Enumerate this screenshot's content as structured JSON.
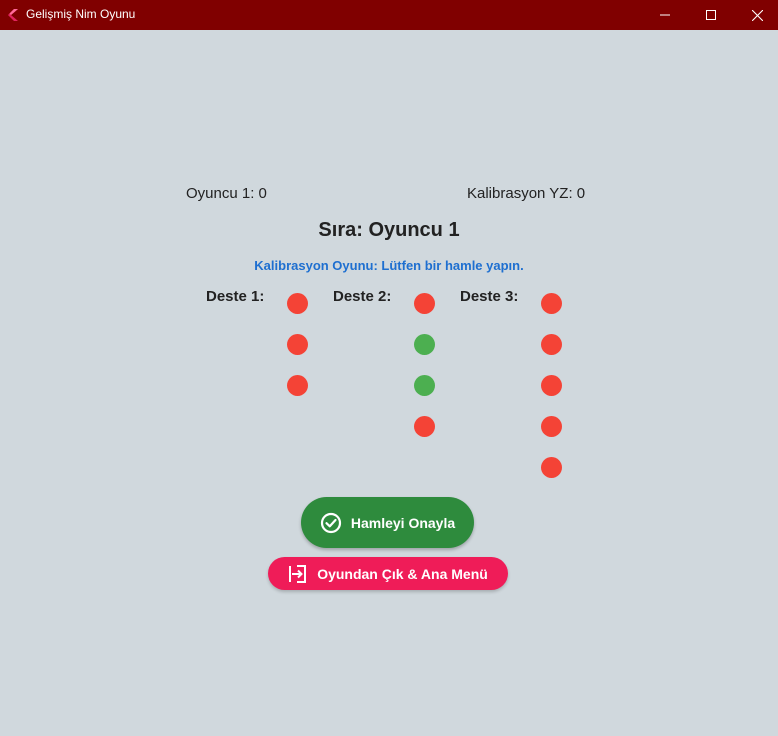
{
  "window": {
    "title": "Gelişmiş Nim Oyunu",
    "icon": "flutter-app-icon",
    "controls": [
      "minimize-icon",
      "maximize-icon",
      "close-icon"
    ]
  },
  "scores": {
    "player1": "Oyuncu 1: 0",
    "ai": "Kalibrasyon YZ: 0"
  },
  "turn": "Sıra: Oyuncu 1",
  "status_message": "Kalibrasyon Oyunu: Lütfen bir hamle yapın.",
  "piles": [
    {
      "label": "Deste 1:",
      "sticks": [
        "red",
        "red",
        "red"
      ]
    },
    {
      "label": "Deste 2:",
      "sticks": [
        "red",
        "green",
        "green",
        "red"
      ]
    },
    {
      "label": "Deste 3:",
      "sticks": [
        "red",
        "red",
        "red",
        "red",
        "red"
      ]
    }
  ],
  "buttons": {
    "confirm": {
      "label": "Hamleyi Onayla",
      "icon": "check-circle-icon"
    },
    "exit": {
      "label": "Oyundan Çık & Ana Menü",
      "icon": "exit-to-app-icon"
    }
  },
  "colors": {
    "titlebar": "#800000",
    "background": "#d0d8dd",
    "stick_default": "#f44336",
    "stick_selected": "#4caf50",
    "status_text": "#1e6fd0",
    "confirm_button": "#2e8b3d",
    "exit_button": "#ef1c58"
  }
}
